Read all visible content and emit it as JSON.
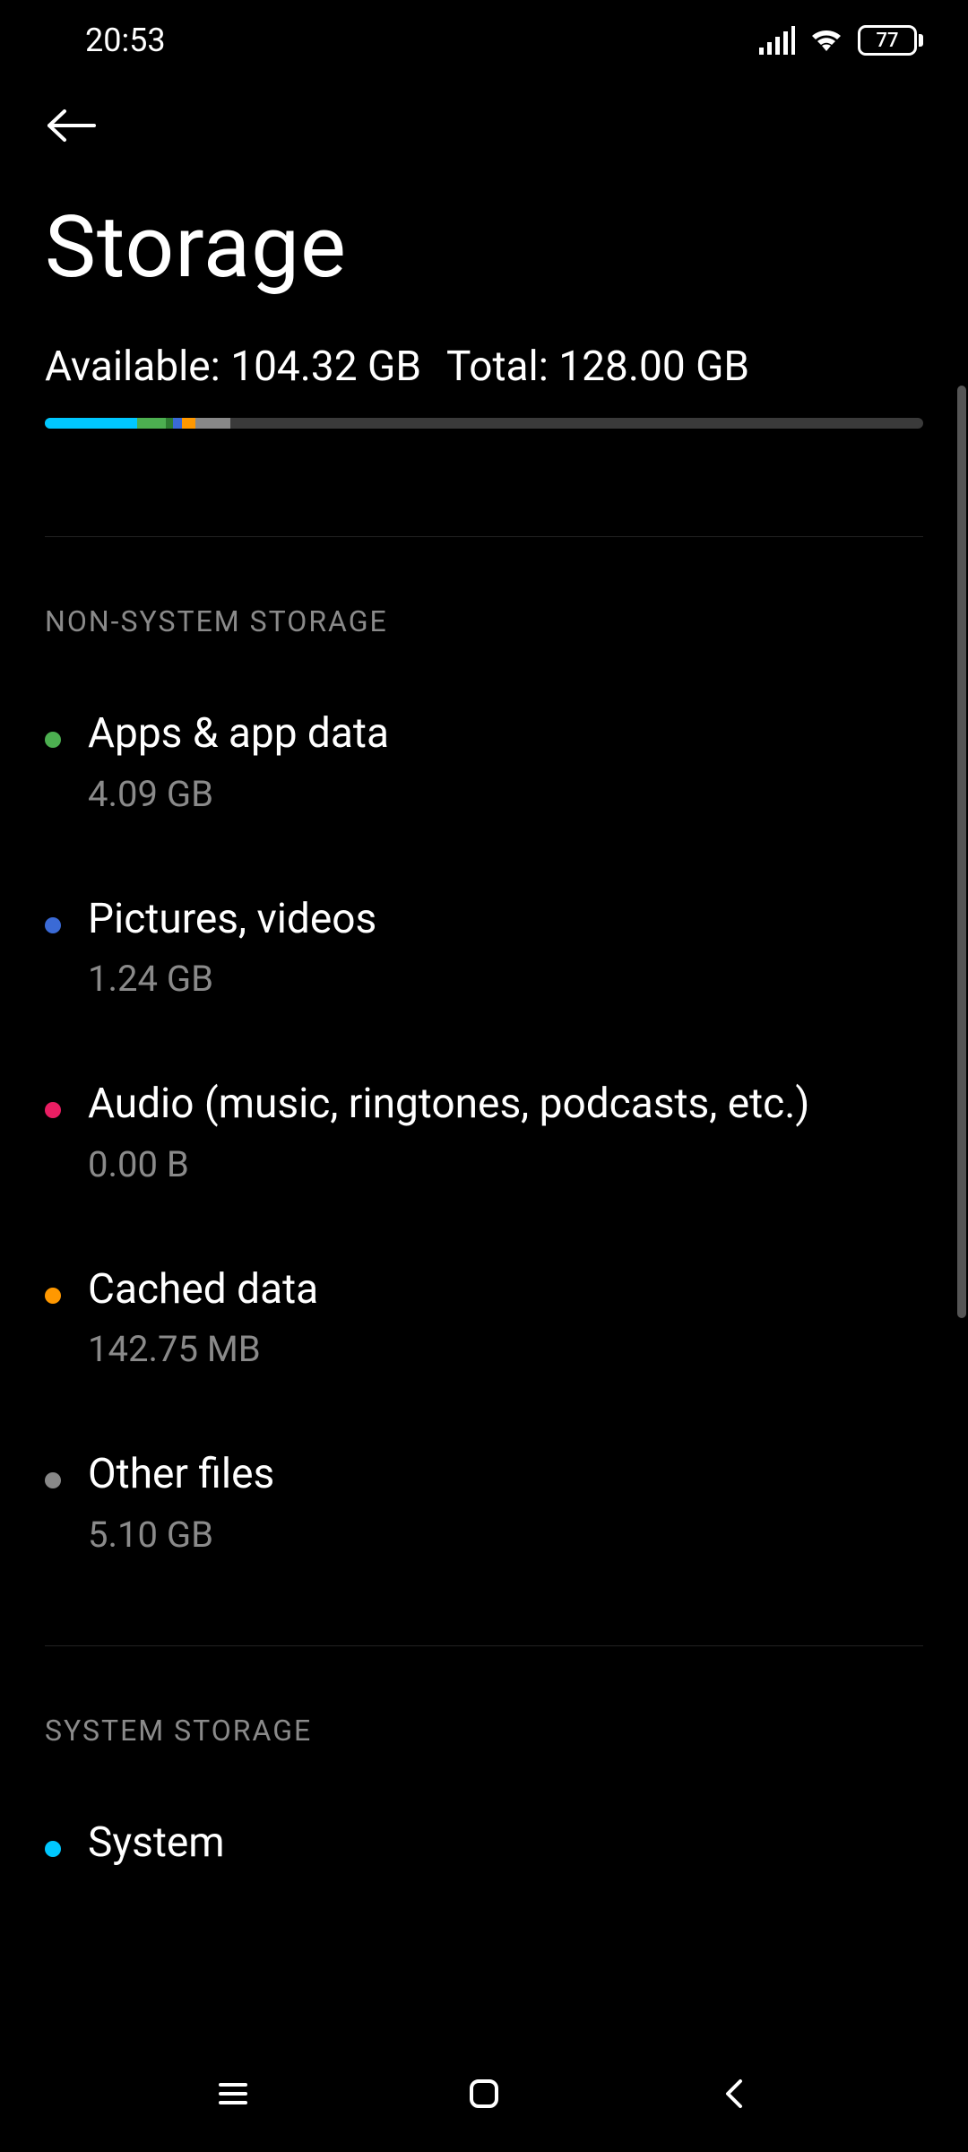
{
  "status": {
    "time": "20:53",
    "battery": "77"
  },
  "page": {
    "title": "Storage"
  },
  "summary": {
    "available_label": "Available:",
    "available_value": "104.32 GB",
    "total_label": "Total:",
    "total_value": "128.00 GB",
    "segments": [
      {
        "color": "#00c8ff",
        "pct": 10.5
      },
      {
        "color": "#4caf50",
        "pct": 3.3
      },
      {
        "color": "#2e7d32",
        "pct": 0.8
      },
      {
        "color": "#3a6ad6",
        "pct": 1.0
      },
      {
        "color": "#ff9800",
        "pct": 1.5
      },
      {
        "color": "#888888",
        "pct": 4.0
      }
    ]
  },
  "sections": {
    "non_system": {
      "header": "NON-SYSTEM STORAGE",
      "items": [
        {
          "dot": "#4caf50",
          "title": "Apps & app data",
          "sub": "4.09 GB"
        },
        {
          "dot": "#3a6ad6",
          "title": "Pictures, videos",
          "sub": "1.24 GB"
        },
        {
          "dot": "#e91e63",
          "title": "Audio (music, ringtones, podcasts, etc.)",
          "sub": "0.00 B"
        },
        {
          "dot": "#ff9800",
          "title": "Cached data",
          "sub": "142.75 MB"
        },
        {
          "dot": "#888888",
          "title": "Other files",
          "sub": "5.10 GB"
        }
      ]
    },
    "system": {
      "header": "SYSTEM STORAGE",
      "items": [
        {
          "dot": "#00c8ff",
          "title": "System",
          "sub": ""
        }
      ]
    }
  }
}
